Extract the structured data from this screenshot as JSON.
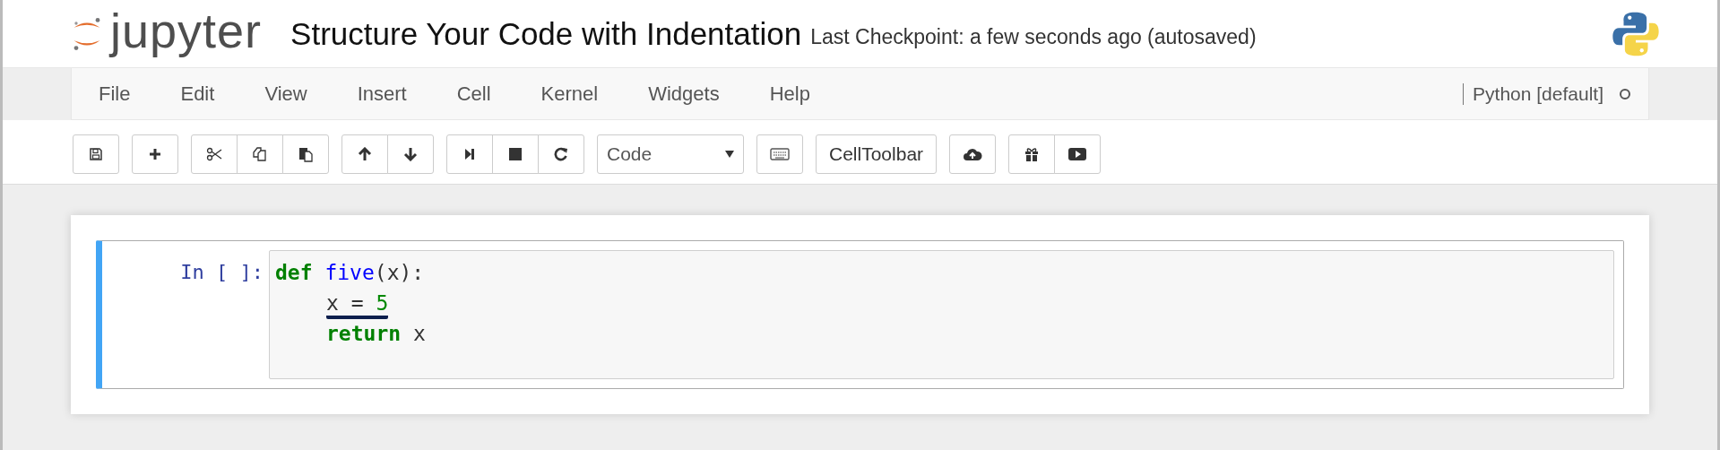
{
  "header": {
    "logo_text": "jupyter",
    "title": "Structure Your Code with Indentation",
    "checkpoint": "Last Checkpoint: a few seconds ago (autosaved)"
  },
  "menu": [
    "File",
    "Edit",
    "View",
    "Insert",
    "Cell",
    "Kernel",
    "Widgets",
    "Help"
  ],
  "kernel": {
    "name": "Python [default]",
    "busy": false
  },
  "toolbar": {
    "cell_type": "Code",
    "cell_toolbar": "CellToolbar"
  },
  "cell": {
    "prompt": "In [ ]:",
    "selected": true,
    "lines": [
      {
        "tokens": [
          {
            "text": "def",
            "kind": "keyword"
          },
          {
            "text": "five",
            "kind": "name",
            "space_before": true
          },
          {
            "text": "(x):",
            "kind": "plain"
          }
        ],
        "underlined": false,
        "children": [
          {
            "tokens": [
              {
                "text": "x = ",
                "kind": "plain"
              },
              {
                "text": "5",
                "kind": "number"
              }
            ],
            "underlined": true
          },
          {
            "tokens": [
              {
                "text": "return",
                "kind": "keyword"
              },
              {
                "text": " x",
                "kind": "plain"
              }
            ],
            "underlined": false
          }
        ]
      }
    ]
  }
}
